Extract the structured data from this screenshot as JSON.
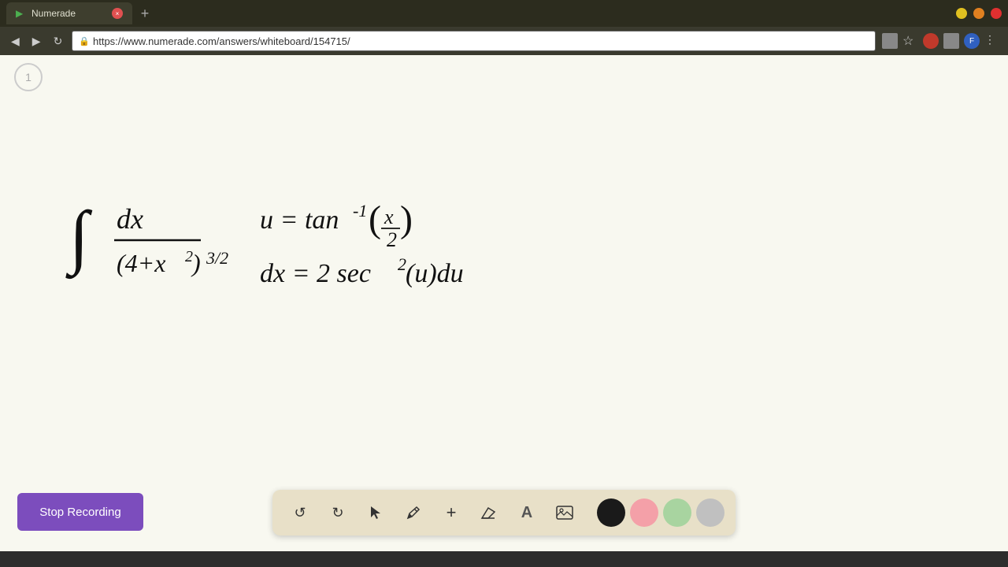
{
  "browser": {
    "tab_title": "Numerade",
    "url": "https://www.numerade.com/answers/whiteboard/154715/",
    "new_tab_label": "+",
    "page_number": "1"
  },
  "toolbar": {
    "undo_label": "↺",
    "redo_label": "↻",
    "select_label": "▲",
    "pen_label": "✏",
    "plus_label": "+",
    "eraser_label": "/",
    "text_label": "A",
    "image_label": "🖼",
    "stop_recording_label": "Stop Recording"
  },
  "colors": {
    "black": "#1a1a1a",
    "pink": "#f4a0a8",
    "green": "#a8d4a0",
    "gray": "#c0c0c0",
    "accent_purple": "#7c4dbd",
    "whiteboard_bg": "#f8f8f0",
    "toolbar_bg": "#e8e0c8"
  }
}
